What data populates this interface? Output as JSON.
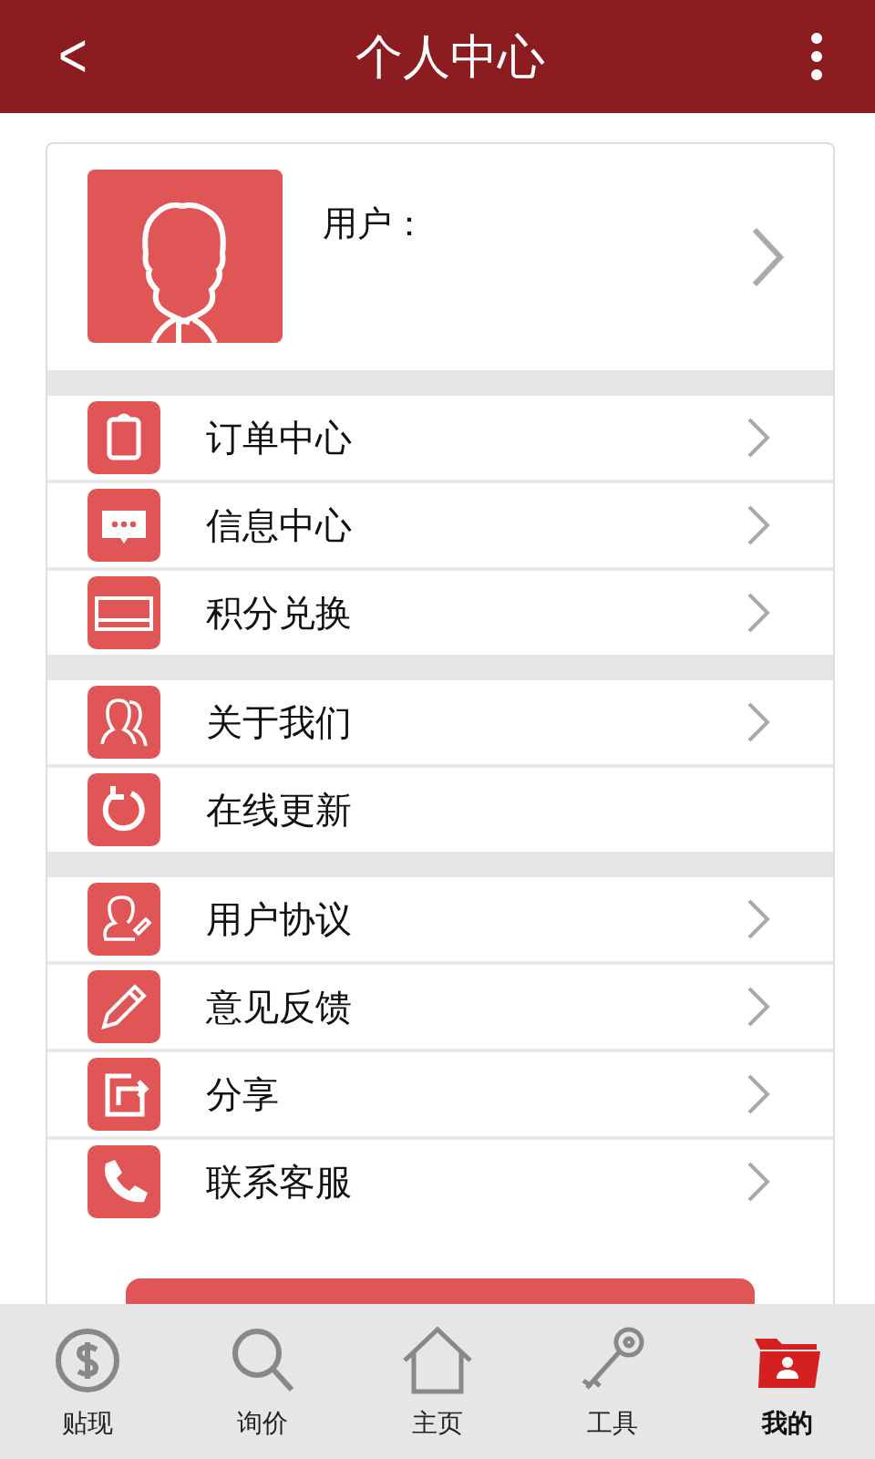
{
  "header": {
    "back": "<",
    "title": "个人中心"
  },
  "profile": {
    "label": "用户："
  },
  "groups": [
    [
      {
        "label": "订单中心",
        "kind": "clipboard",
        "chevron": true
      },
      {
        "label": "信息中心",
        "kind": "message",
        "chevron": true
      },
      {
        "label": "积分兑换",
        "kind": "card",
        "chevron": true
      }
    ],
    [
      {
        "label": "关于我们",
        "kind": "people",
        "chevron": true
      },
      {
        "label": "在线更新",
        "kind": "refresh",
        "chevron": false
      }
    ],
    [
      {
        "label": "用户协议",
        "kind": "useredit",
        "chevron": true
      },
      {
        "label": "意见反馈",
        "kind": "pencil",
        "chevron": true
      },
      {
        "label": "分享",
        "kind": "share",
        "chevron": true
      },
      {
        "label": "联系客服",
        "kind": "phone",
        "chevron": true
      }
    ]
  ],
  "tabs": [
    {
      "label": "贴现",
      "kind": "dollar",
      "selected": false
    },
    {
      "label": "询价",
      "kind": "search",
      "selected": false
    },
    {
      "label": "主页",
      "kind": "home",
      "selected": false
    },
    {
      "label": "工具",
      "kind": "key",
      "selected": false
    },
    {
      "label": "我的",
      "kind": "folder",
      "selected": true
    }
  ]
}
